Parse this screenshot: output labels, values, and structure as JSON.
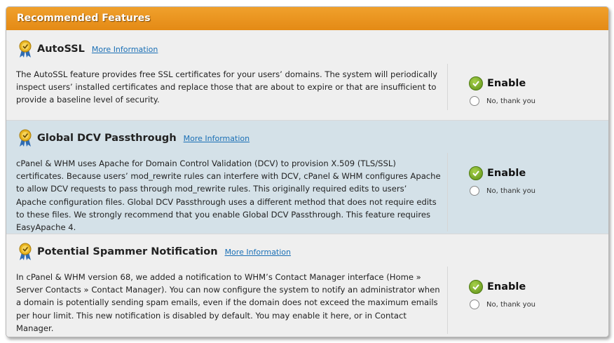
{
  "header": {
    "title": "Recommended Features"
  },
  "features": [
    {
      "title": "AutoSSL",
      "more_info": "More Information",
      "desc_lines": [
        "The AutoSSL feature provides free SSL certificates for your users’ domains. The system will periodically",
        "inspect users’ installed certificates and replace those that are about to expire or that are insufficient to",
        "provide a baseline level of security."
      ],
      "enable_label": "Enable",
      "decline_label": "No, thank you"
    },
    {
      "title": "Global DCV Passthrough",
      "more_info": "More Information",
      "desc_lines": [
        "cPanel & WHM uses Apache for Domain Control Validation (DCV) to provision X.509 (TLS/SSL)",
        "certificates. Because users’ mod_rewrite rules can interfere with DCV, cPanel & WHM configures Apache",
        "to allow DCV requests to pass through mod_rewrite rules. This originally required edits to users’",
        "Apache configuration files. Global DCV Passthrough uses a different method that does not require edits",
        "to these files. We strongly recommend that you enable Global DCV Passthrough. This feature requires",
        "EasyApache 4."
      ],
      "enable_label": "Enable",
      "decline_label": "No, thank you"
    },
    {
      "title": "Potential Spammer Notification",
      "more_info": "More Information",
      "desc_lines": [
        "In cPanel & WHM version 68, we added a notification to WHM’s Contact Manager interface (Home »",
        "Server Contacts » Contact Manager). You can now configure the system to notify an administrator when",
        "a domain is potentially sending spam emails, even if the domain does not exceed the maximum emails",
        "per hour limit. This new notification is disabled by default. You may enable it here, or in Contact",
        "Manager."
      ],
      "enable_label": "Enable",
      "decline_label": "No, thank you"
    }
  ],
  "colors": {
    "header": "#e8901c",
    "check": "#6a9e1f",
    "link": "#1a6fb5",
    "highlight_row": "#d4e1e8"
  },
  "icons": {
    "feature": "award-ribbon-icon",
    "enable": "check-circle-icon"
  }
}
